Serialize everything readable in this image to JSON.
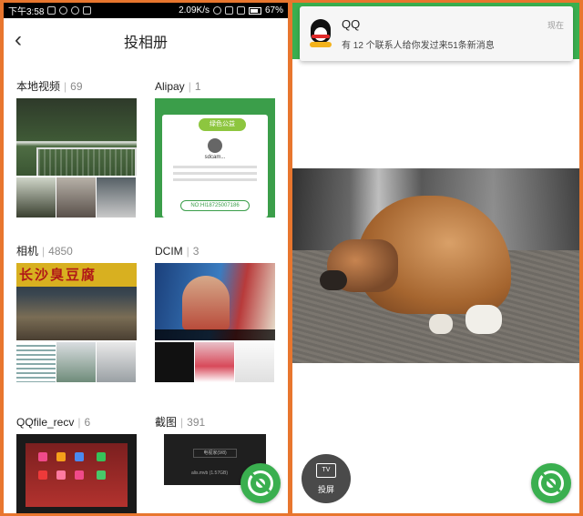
{
  "left": {
    "statusbar": {
      "time": "下午3:58",
      "network_speed": "2.09K/s",
      "battery": "67%"
    },
    "header": {
      "back_glyph": "‹",
      "title": "投相册"
    },
    "albums": [
      {
        "name": "本地视频",
        "count": "69"
      },
      {
        "name": "Alipay",
        "count": "1"
      },
      {
        "name": "相机",
        "count": "4850"
      },
      {
        "name": "DCIM",
        "count": "3"
      },
      {
        "name": "QQfile_recv",
        "count": "6"
      },
      {
        "name": "截图",
        "count": "391"
      }
    ],
    "thumb_text": {
      "camera_sign": "长沙臭豆腐",
      "alipay_user": "sdcam...",
      "alipay_code": "NO:HI18725007186",
      "alipay_badge": "绿色公益",
      "shot_dialog": "电视家(9/8)",
      "shot_file": "alis.mvb (1.57GB)"
    }
  },
  "right": {
    "notification": {
      "app": "QQ",
      "message": "有 12 个联系人给你发过来51条新消息",
      "time": "现在"
    },
    "cast_button": {
      "icon_text": "TV",
      "label": "投屏"
    }
  },
  "colors": {
    "accent_green": "#3aaf4f",
    "frame_orange": "#e8762e",
    "qq_red": "#e02a2a"
  },
  "icons": {
    "remote": "remote-control-icon",
    "back": "chevron-left-icon",
    "qq": "qq-penguin-icon"
  }
}
